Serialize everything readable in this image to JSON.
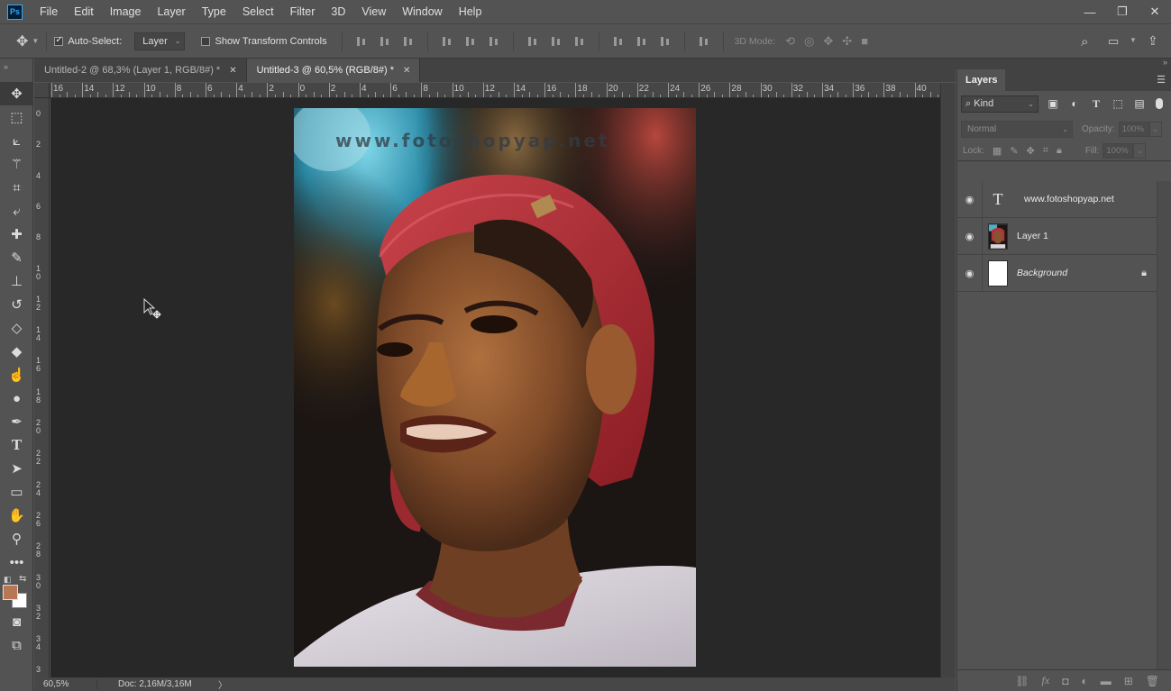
{
  "app": {
    "logo": "Ps"
  },
  "menu": [
    "File",
    "Edit",
    "Image",
    "Layer",
    "Type",
    "Select",
    "Filter",
    "3D",
    "View",
    "Window",
    "Help"
  ],
  "window_controls": {
    "minimize": "—",
    "restore": "❐",
    "close": "✕"
  },
  "options": {
    "auto_select_label": "Auto-Select:",
    "auto_select_checked": true,
    "auto_select_target": "Layer",
    "transform_controls_label": "Show Transform Controls",
    "mode3d_label": "3D Mode:"
  },
  "tabs": [
    {
      "label": "Untitled-2 @ 68,3% (Layer 1, RGB/8#) *",
      "active": false
    },
    {
      "label": "Untitled-3 @ 60,5% (RGB/8#) *",
      "active": true
    }
  ],
  "ruler_h_labels": [
    "16",
    "14",
    "12",
    "10",
    "8",
    "6",
    "4",
    "2",
    "0",
    "2",
    "4",
    "6",
    "8",
    "10",
    "12",
    "14",
    "16",
    "18",
    "20",
    "22",
    "24",
    "26",
    "28",
    "30",
    "32",
    "34",
    "36",
    "38",
    "40"
  ],
  "ruler_v_labels": [
    "0",
    "2",
    "4",
    "6",
    "8",
    "10",
    "12",
    "14",
    "16",
    "18",
    "20",
    "22",
    "24",
    "26",
    "28",
    "30",
    "32",
    "34",
    "3"
  ],
  "canvas": {
    "watermark": "www.fotoshopyap.net"
  },
  "status": {
    "zoom": "60,5%",
    "doc": "Doc: 2,16M/3,16M",
    "arrow": "〉"
  },
  "colors": {
    "foreground": "#b77754",
    "background": "#ffffff",
    "accent": "#31a8ff"
  },
  "tools": [
    "move-tool",
    "marquee-tool",
    "lasso-tool",
    "magic-wand-tool",
    "crop-tool",
    "eyedropper-tool",
    "healing-brush-tool",
    "brush-tool",
    "clone-stamp-tool",
    "history-brush-tool",
    "eraser-tool",
    "paint-bucket-tool",
    "smudge-tool",
    "dodge-tool",
    "pen-tool",
    "type-tool",
    "path-selection-tool",
    "rectangle-tool",
    "hand-tool",
    "zoom-tool",
    "more-tools"
  ],
  "layers_panel": {
    "title": "Layers",
    "kind_label": "Kind",
    "blend_mode": "Normal",
    "opacity_label": "Opacity:",
    "opacity_value": "100%",
    "lock_label": "Lock:",
    "fill_label": "Fill:",
    "fill_value": "100%",
    "layers": [
      {
        "name": "www.fotoshopyap.net",
        "type": "text",
        "visible": true
      },
      {
        "name": "Layer 1",
        "type": "image",
        "visible": true
      },
      {
        "name": "Background",
        "type": "background",
        "visible": true,
        "locked": true
      }
    ]
  }
}
